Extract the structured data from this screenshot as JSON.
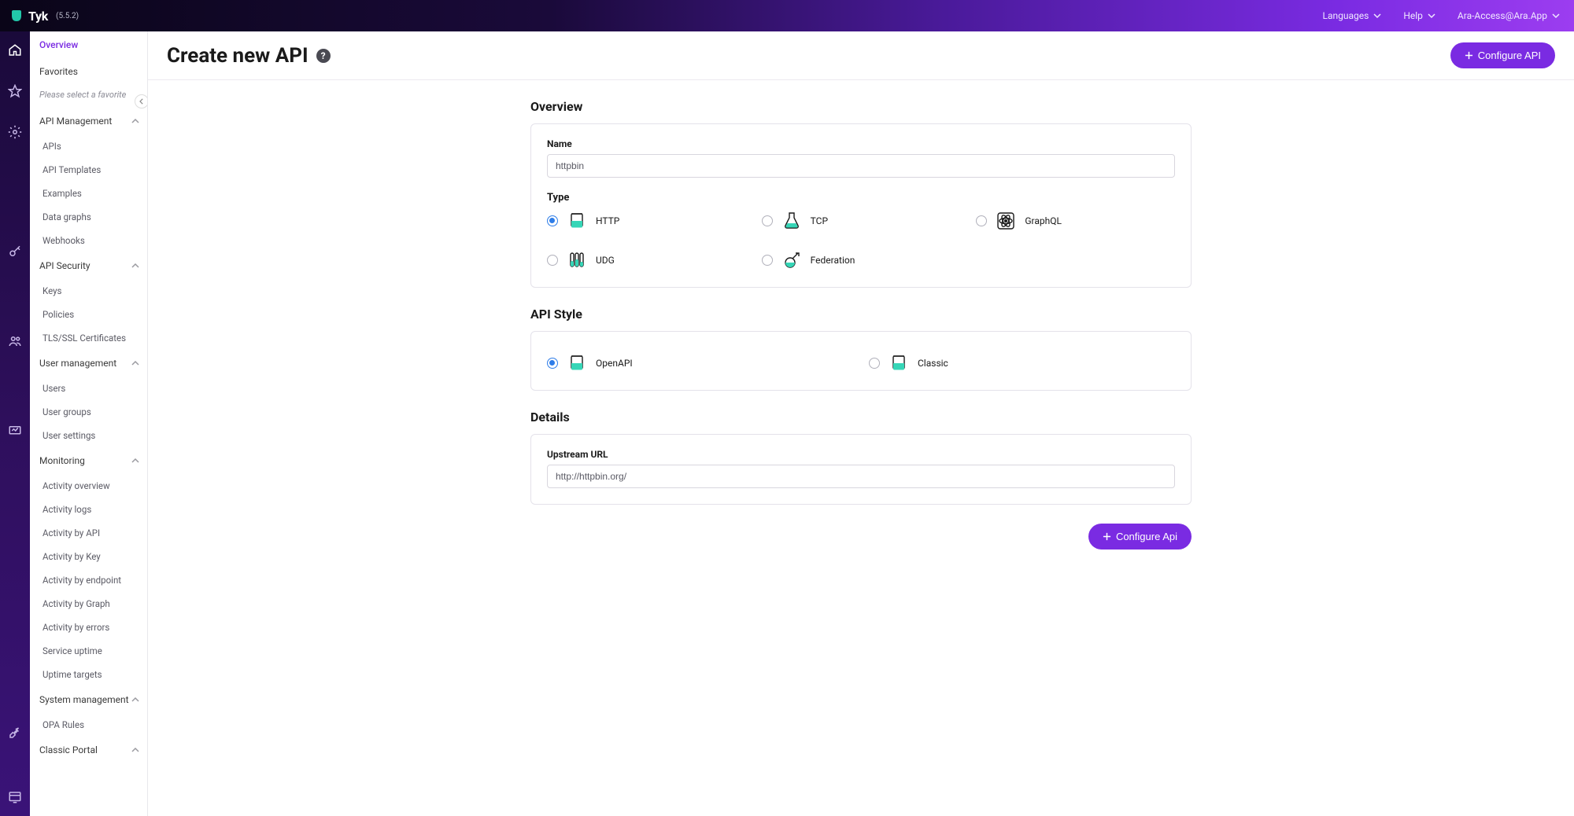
{
  "topbar": {
    "brand": "Tyk",
    "version": "(5.5.2)",
    "languages": "Languages",
    "help": "Help",
    "account": "Ara-Access@Ara.App"
  },
  "sidebar": {
    "overview": "Overview",
    "favorites": "Favorites",
    "favorites_empty": "Please select a favorite",
    "groups": {
      "api_management": {
        "label": "API Management",
        "items": [
          "APIs",
          "API Templates",
          "Examples",
          "Data graphs",
          "Webhooks"
        ]
      },
      "api_security": {
        "label": "API Security",
        "items": [
          "Keys",
          "Policies",
          "TLS/SSL Certificates"
        ]
      },
      "user_management": {
        "label": "User management",
        "items": [
          "Users",
          "User groups",
          "User settings"
        ]
      },
      "monitoring": {
        "label": "Monitoring",
        "items": [
          "Activity overview",
          "Activity logs",
          "Activity by API",
          "Activity by Key",
          "Activity by endpoint",
          "Activity by Graph",
          "Activity by errors",
          "Service uptime",
          "Uptime targets"
        ]
      },
      "system_management": {
        "label": "System management",
        "items": [
          "OPA Rules"
        ]
      },
      "classic_portal": {
        "label": "Classic Portal",
        "items": []
      }
    }
  },
  "page": {
    "title": "Create new API",
    "configure_top": "Configure API",
    "configure_bottom": "Configure Api"
  },
  "overview": {
    "heading": "Overview",
    "name_label": "Name",
    "name_value": "httpbin",
    "type_label": "Type",
    "types": {
      "http": "HTTP",
      "tcp": "TCP",
      "graphql": "GraphQL",
      "udg": "UDG",
      "federation": "Federation"
    }
  },
  "api_style": {
    "heading": "API Style",
    "openapi": "OpenAPI",
    "classic": "Classic"
  },
  "details": {
    "heading": "Details",
    "upstream_label": "Upstream URL",
    "upstream_value": "http://httpbin.org/"
  }
}
